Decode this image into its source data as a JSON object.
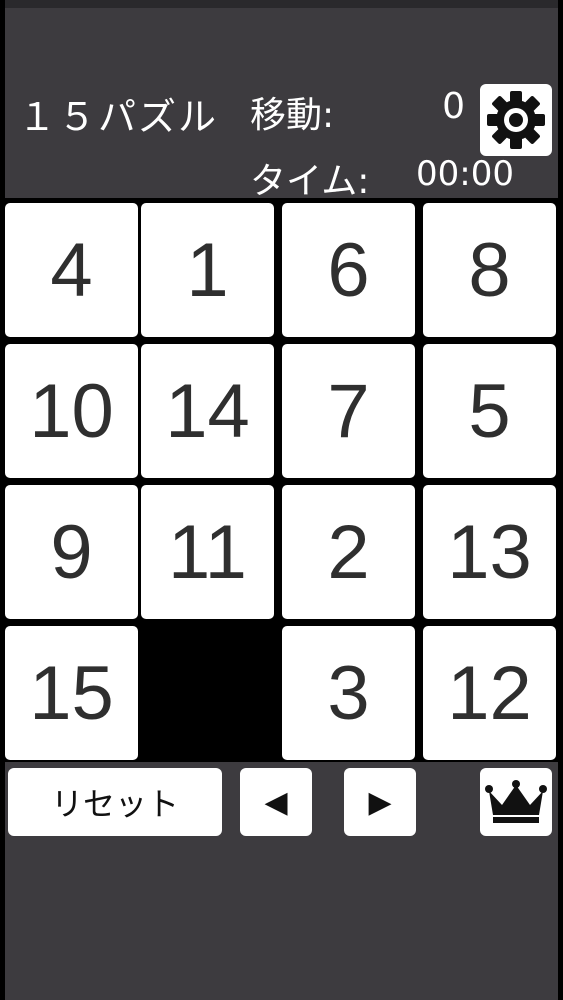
{
  "header": {
    "title": "１５パズル",
    "moves_label": "移動:",
    "moves_value": "0",
    "time_label": "タイム:",
    "time_value": "00:00"
  },
  "icons": {
    "settings": "gear-icon",
    "ranking": "crown-icon",
    "prev": "left-triangle-icon",
    "next": "right-triangle-icon"
  },
  "board": {
    "rows": [
      [
        "4",
        "1",
        "6",
        "8"
      ],
      [
        "10",
        "14",
        "7",
        "5"
      ],
      [
        "9",
        "11",
        "2",
        "13"
      ],
      [
        "15",
        "",
        "3",
        "12"
      ]
    ]
  },
  "controls": {
    "reset_label": "リセット",
    "prev_label": "◀",
    "next_label": "▶"
  },
  "colors": {
    "background": "#3d3b3f",
    "tile": "#ffffff",
    "tile_text": "#2f2f2f",
    "board_gap": "#000000"
  }
}
